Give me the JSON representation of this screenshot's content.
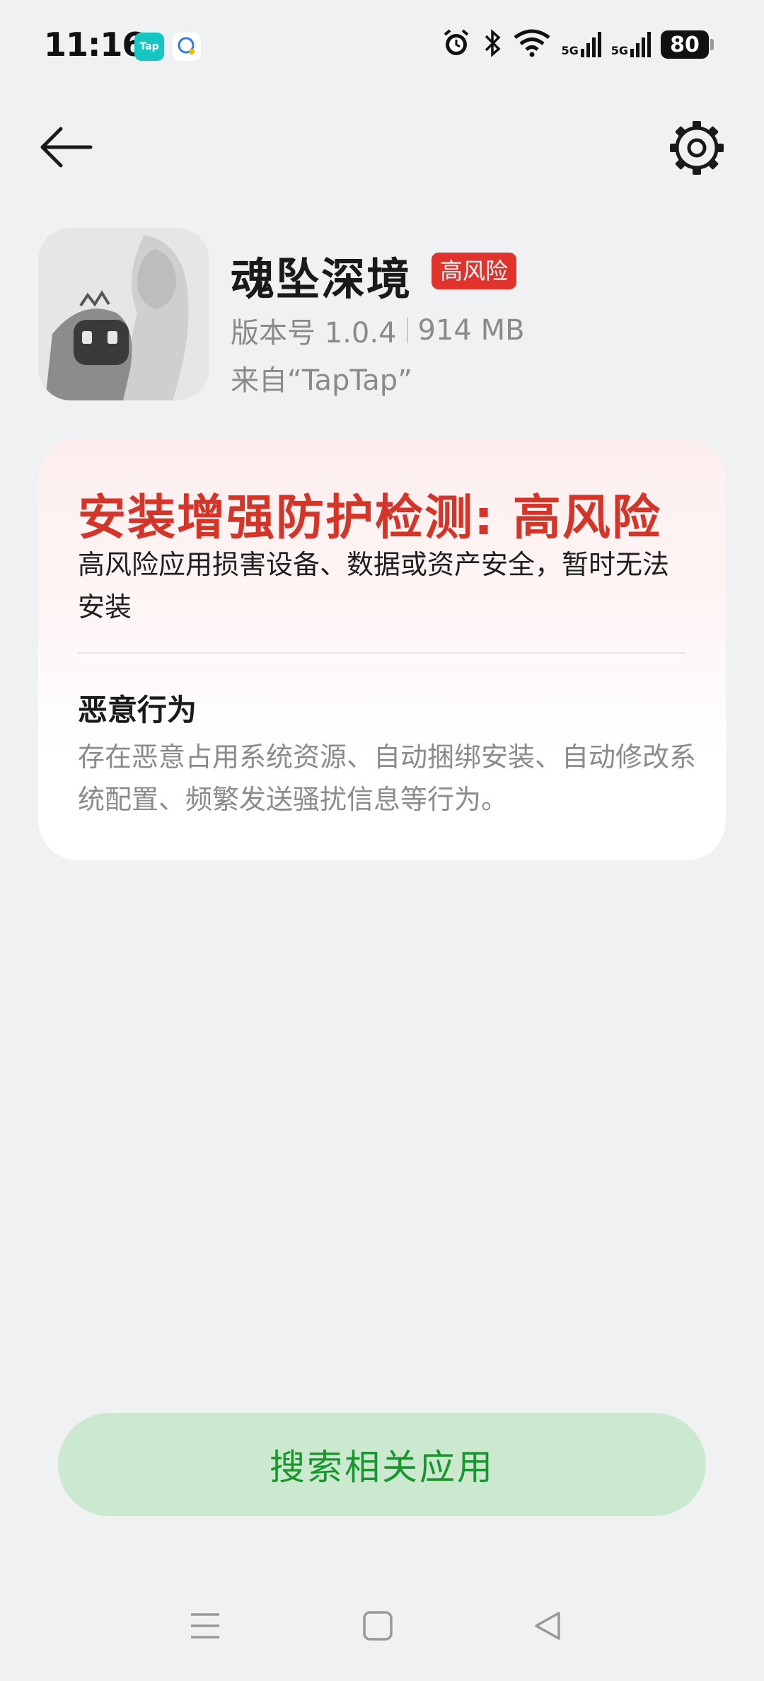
{
  "status_bar": {
    "time": "11:16",
    "app1_label": "Tap",
    "net1": "5G",
    "net2": "5G",
    "battery": "80"
  },
  "app": {
    "name": "魂坠深境",
    "risk_badge": "高风险",
    "version": "版本号 1.0.4",
    "size": "914 MB",
    "source": "来自“TapTap”"
  },
  "risk_card": {
    "title": "安装增强防护检测: 高风险",
    "description": "高风险应用损害设备、数据或资产安全，暂时无法安装",
    "behavior_title": "恶意行为",
    "behavior_description": "存在恶意占用系统资源、自动捆绑安装、自动修改系统配置、频繁发送骚扰信息等行为。"
  },
  "actions": {
    "search_label": "搜索相关应用"
  },
  "colors": {
    "danger": "#d53429",
    "badge": "#e2322c",
    "button_bg": "#cbe9cf",
    "button_text": "#18952c"
  },
  "icons": [
    "back-arrow-icon",
    "settings-gear-icon",
    "alarm-icon",
    "bluetooth-icon",
    "wifi-icon",
    "menu-icon",
    "home-icon",
    "back-triangle-icon"
  ]
}
